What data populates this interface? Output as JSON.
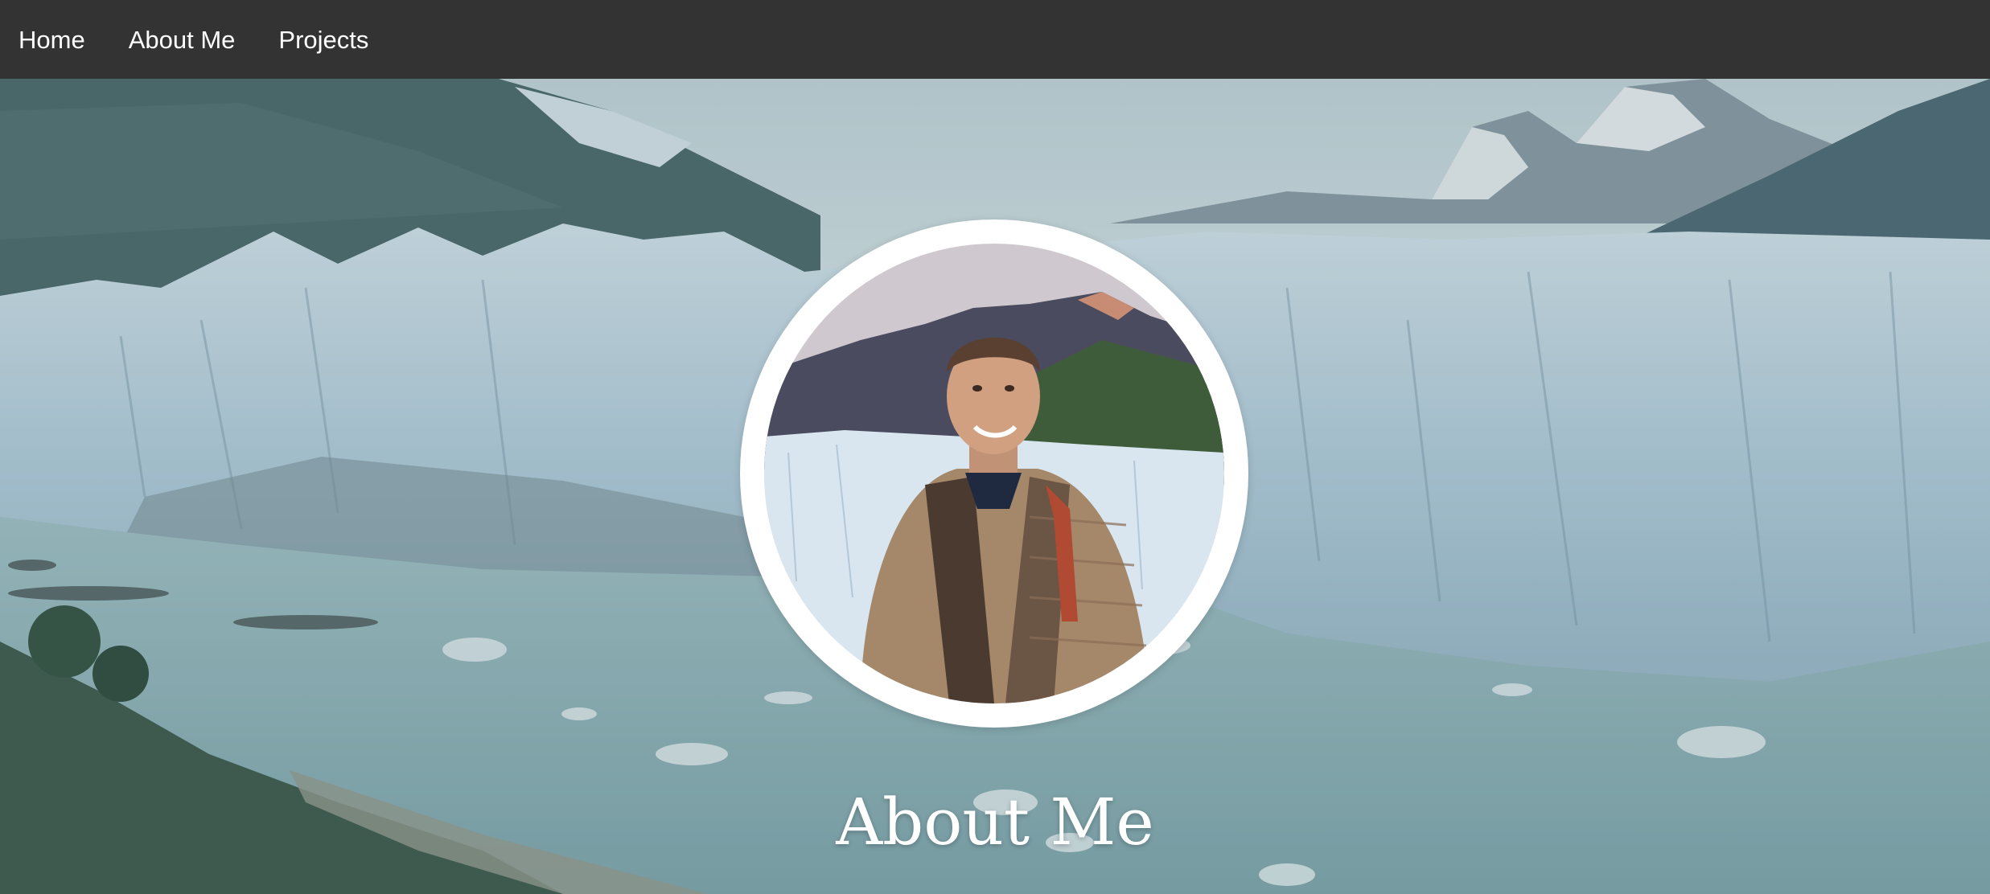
{
  "nav": {
    "items": [
      {
        "label": "Home"
      },
      {
        "label": "About Me"
      },
      {
        "label": "Projects"
      }
    ]
  },
  "hero": {
    "heading": "About Me",
    "background": "glacier-landscape-photo",
    "portrait": "profile-photo"
  },
  "colors": {
    "nav_bg": "#333333",
    "nav_text": "#ffffff",
    "heading_text": "#ffffff",
    "avatar_ring": "#ffffff"
  }
}
